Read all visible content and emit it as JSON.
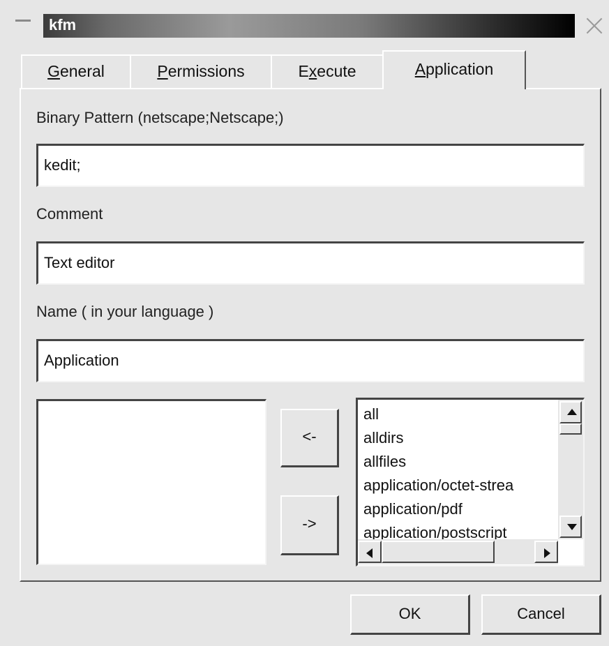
{
  "window": {
    "title": "kfm"
  },
  "tabs": [
    {
      "label_mn": "G",
      "label_rest": "eneral"
    },
    {
      "label_mn": "P",
      "label_rest": "ermissions"
    },
    {
      "label_pre": "E",
      "label_mn": "x",
      "label_rest": "ecute"
    },
    {
      "label_mn": "A",
      "label_rest": "pplication"
    }
  ],
  "form": {
    "binary_pattern_label": "Binary Pattern (netscape;Netscape;)",
    "binary_pattern_value": "kedit;",
    "comment_label": "Comment",
    "comment_value": "Text editor",
    "name_label": "Name ( in your language )",
    "name_value": "Application"
  },
  "mime": {
    "move_left_label": "<-",
    "move_right_label": "->",
    "available_types": [
      "all",
      "alldirs",
      "allfiles",
      "application/octet-strea",
      "application/pdf",
      "application/postscript"
    ]
  },
  "footer": {
    "ok_label": "OK",
    "cancel_label": "Cancel"
  },
  "icons": {
    "window_menu": "window-menu-icon",
    "close": "close-icon",
    "scroll_up": "arrow-up-icon",
    "scroll_down": "arrow-down-icon",
    "scroll_left": "arrow-left-icon",
    "scroll_right": "arrow-right-icon"
  },
  "colors": {
    "background": "#e6e6e6",
    "field": "#ffffff",
    "title_bar": "#000000"
  }
}
